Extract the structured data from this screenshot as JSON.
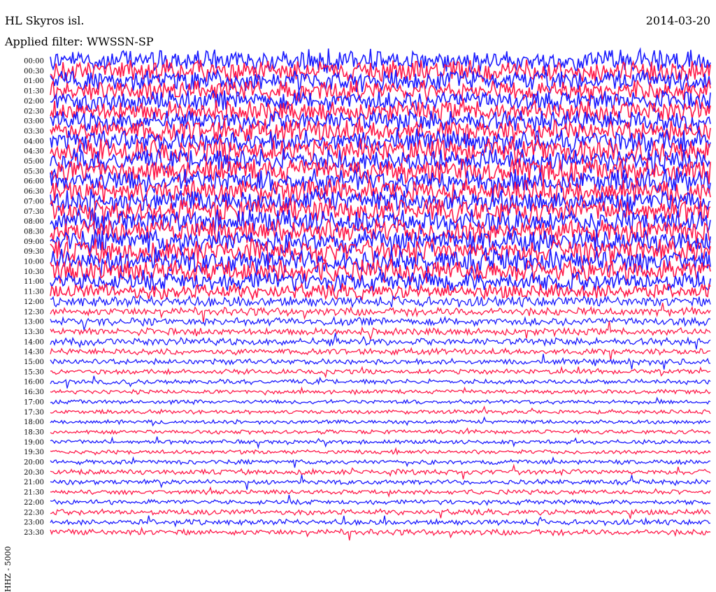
{
  "header": {
    "station": "HL Skyros isl.",
    "date": "2014-03-20",
    "filter": "Applied filter: WWSSN-SP"
  },
  "chart_data": {
    "type": "line",
    "title": "HL Skyros isl.",
    "ylabel": "HHZ - 5000",
    "colors": [
      "#1a1aff",
      "#ff1a4a"
    ],
    "rows": [
      {
        "label": "00:00",
        "amp": 0.95
      },
      {
        "label": "00:30",
        "amp": 0.9
      },
      {
        "label": "01:00",
        "amp": 0.9
      },
      {
        "label": "01:30",
        "amp": 0.85
      },
      {
        "label": "02:00",
        "amp": 0.85
      },
      {
        "label": "02:30",
        "amp": 0.85
      },
      {
        "label": "03:00",
        "amp": 0.85
      },
      {
        "label": "03:30",
        "amp": 0.9
      },
      {
        "label": "04:00",
        "amp": 0.95
      },
      {
        "label": "04:30",
        "amp": 1.0
      },
      {
        "label": "05:00",
        "amp": 1.0
      },
      {
        "label": "05:30",
        "amp": 1.0
      },
      {
        "label": "06:00",
        "amp": 1.0
      },
      {
        "label": "06:30",
        "amp": 1.0
      },
      {
        "label": "07:00",
        "amp": 1.0
      },
      {
        "label": "07:30",
        "amp": 1.0
      },
      {
        "label": "08:00",
        "amp": 1.0
      },
      {
        "label": "08:30",
        "amp": 1.0
      },
      {
        "label": "09:00",
        "amp": 1.0
      },
      {
        "label": "09:30",
        "amp": 1.0
      },
      {
        "label": "10:00",
        "amp": 1.0
      },
      {
        "label": "10:30",
        "amp": 0.95
      },
      {
        "label": "11:00",
        "amp": 0.8
      },
      {
        "label": "11:30",
        "amp": 0.6
      },
      {
        "label": "12:00",
        "amp": 0.4
      },
      {
        "label": "12:30",
        "amp": 0.3
      },
      {
        "label": "13:00",
        "amp": 0.3
      },
      {
        "label": "13:30",
        "amp": 0.25
      },
      {
        "label": "14:00",
        "amp": 0.25
      },
      {
        "label": "14:30",
        "amp": 0.2
      },
      {
        "label": "15:00",
        "amp": 0.2
      },
      {
        "label": "15:30",
        "amp": 0.15
      },
      {
        "label": "16:00",
        "amp": 0.15
      },
      {
        "label": "16:30",
        "amp": 0.12
      },
      {
        "label": "17:00",
        "amp": 0.12
      },
      {
        "label": "17:30",
        "amp": 0.12
      },
      {
        "label": "18:00",
        "amp": 0.12
      },
      {
        "label": "18:30",
        "amp": 0.12
      },
      {
        "label": "19:00",
        "amp": 0.12
      },
      {
        "label": "19:30",
        "amp": 0.12
      },
      {
        "label": "20:00",
        "amp": 0.14
      },
      {
        "label": "20:30",
        "amp": 0.18
      },
      {
        "label": "21:00",
        "amp": 0.15
      },
      {
        "label": "21:30",
        "amp": 0.14
      },
      {
        "label": "22:00",
        "amp": 0.15
      },
      {
        "label": "22:30",
        "amp": 0.18
      },
      {
        "label": "23:00",
        "amp": 0.18
      },
      {
        "label": "23:30",
        "amp": 0.2
      }
    ]
  }
}
